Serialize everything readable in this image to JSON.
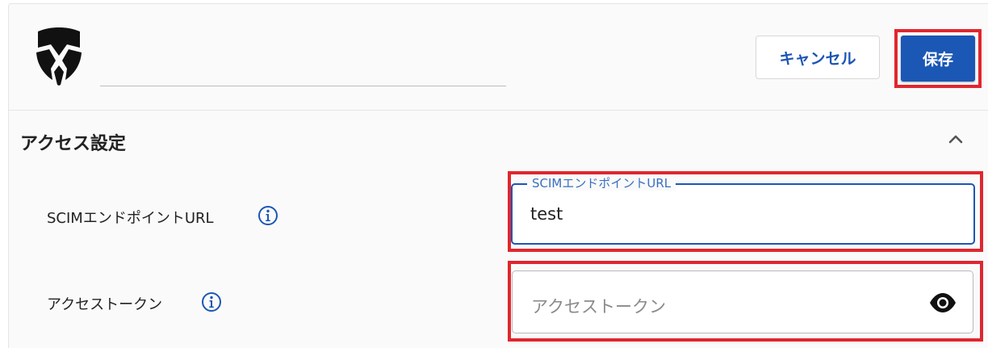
{
  "header": {
    "cancel_label": "キャンセル",
    "save_label": "保存"
  },
  "section": {
    "title": "アクセス設定"
  },
  "fields": {
    "scim_url": {
      "row_label": "SCIMエンドポイントURL",
      "floating_label": "SCIMエンドポイントURL",
      "value": "test"
    },
    "access_token": {
      "row_label": "アクセストークン",
      "placeholder": "アクセストークン"
    }
  },
  "icons": {
    "logo": "shield-logo-icon",
    "collapse": "chevron-up-icon",
    "info": "info-icon",
    "visibility": "eye-icon"
  },
  "colors": {
    "accent": "#1b57b5",
    "highlight": "#e0262e"
  }
}
